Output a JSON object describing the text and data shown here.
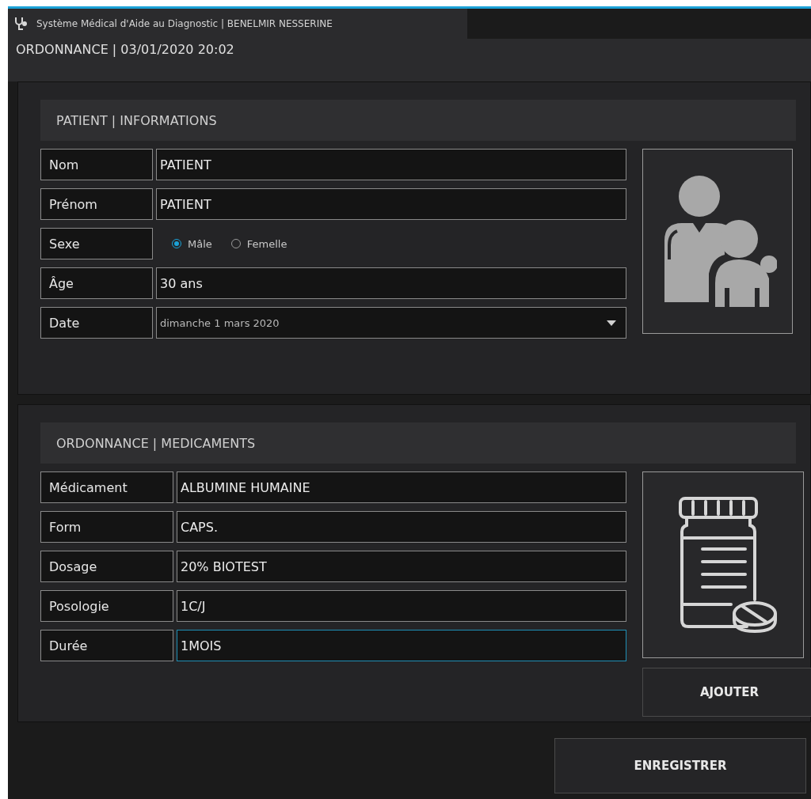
{
  "window": {
    "title": "Système Médical d'Aide au Diagnostic |  BENELMIR NESSERINE",
    "subtitle": "ORDONNANCE | 03/01/2020 20:02"
  },
  "patient": {
    "heading": "PATIENT | INFORMATIONS",
    "fields": [
      {
        "kind": "text",
        "label": "Nom",
        "value": "PATIENT",
        "focused": false
      },
      {
        "kind": "text",
        "label": "Prénom",
        "value": "PATIENT",
        "focused": false
      },
      {
        "kind": "radio",
        "label": "Sexe",
        "options": [
          {
            "label": "Mâle",
            "selected": true
          },
          {
            "label": "Femelle",
            "selected": false
          }
        ]
      },
      {
        "kind": "text",
        "label": "Âge",
        "value": "30 ans",
        "focused": false
      },
      {
        "kind": "dropdown",
        "label": "Date",
        "value": "dimanche 1 mars 2020"
      }
    ]
  },
  "prescription": {
    "heading": "ORDONNANCE | MEDICAMENTS",
    "fields": [
      {
        "kind": "text",
        "label": "Médicament",
        "value": "ALBUMINE HUMAINE",
        "focused": false
      },
      {
        "kind": "text",
        "label": "Form",
        "value": "CAPS.",
        "focused": false
      },
      {
        "kind": "text",
        "label": "Dosage",
        "value": "20% BIOTEST",
        "focused": false
      },
      {
        "kind": "text",
        "label": "Posologie",
        "value": "1C/J",
        "focused": false
      },
      {
        "kind": "text",
        "label": "Durée",
        "value": "1MOIS",
        "focused": true
      }
    ],
    "add_button": "AJOUTER"
  },
  "save_button": "ENREGISTRER"
}
